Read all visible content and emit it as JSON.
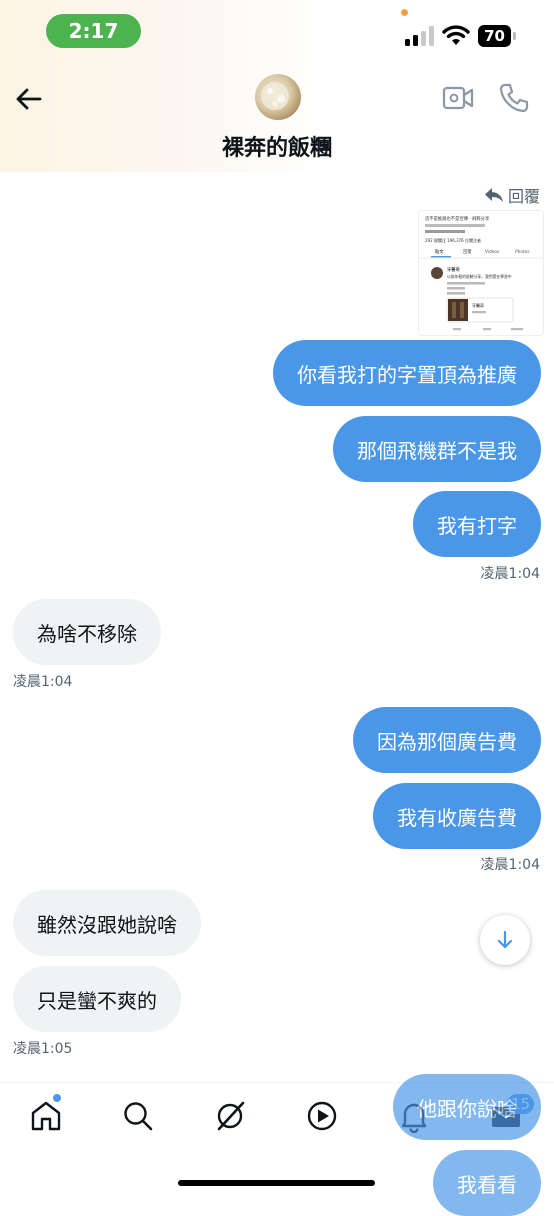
{
  "status_bar": {
    "time": "2:17",
    "battery": "70"
  },
  "header": {
    "contact_name": "裸奔的飯糰"
  },
  "reply_label": "回覆",
  "attachment": {
    "heading": "這不是推銷也不是宣傳 ‧ 純粹分享",
    "stats": "292 個關注  196,376 位關注者",
    "tabs": [
      "貼文",
      "回覆",
      "Videos",
      "Photos"
    ],
    "post_author": "牙醫奇",
    "post_text": "以前年輕的經驗分享，我們還在學習中",
    "post_link": "牙醫奇"
  },
  "messages": [
    {
      "side": "out",
      "text": "你看我打的字置頂為推廣"
    },
    {
      "side": "out",
      "text": "那個飛機群不是我"
    },
    {
      "side": "out",
      "text": "我有打字"
    },
    {
      "side": "out_time",
      "text": "凌晨1:04"
    },
    {
      "side": "in",
      "text": "為啥不移除"
    },
    {
      "side": "in_time",
      "text": "凌晨1:04"
    },
    {
      "side": "out",
      "text": "因為那個廣告費"
    },
    {
      "side": "out",
      "text": "我有收廣告費"
    },
    {
      "side": "out_time",
      "text": "凌晨1:04"
    },
    {
      "side": "in",
      "text": "雖然沒跟她說啥"
    },
    {
      "side": "in",
      "text": "只是蠻不爽的"
    },
    {
      "side": "in_time",
      "text": "凌晨1:05"
    },
    {
      "side": "out",
      "text": "他跟你說啥"
    },
    {
      "side": "out",
      "text": "我看看"
    }
  ],
  "bottom_nav": {
    "messages_badge": "15"
  },
  "colors": {
    "bubble_out": "#4a97e8",
    "bubble_in": "#eff3f4",
    "status_time_bg": "#4cb34f",
    "accent": "#4a97e8"
  },
  "icons": [
    "back-arrow-icon",
    "video-call-icon",
    "phone-call-icon",
    "reply-icon",
    "scroll-down-arrow-icon",
    "home-icon",
    "search-icon",
    "grok-icon",
    "play-icon",
    "bell-icon",
    "mail-icon"
  ]
}
